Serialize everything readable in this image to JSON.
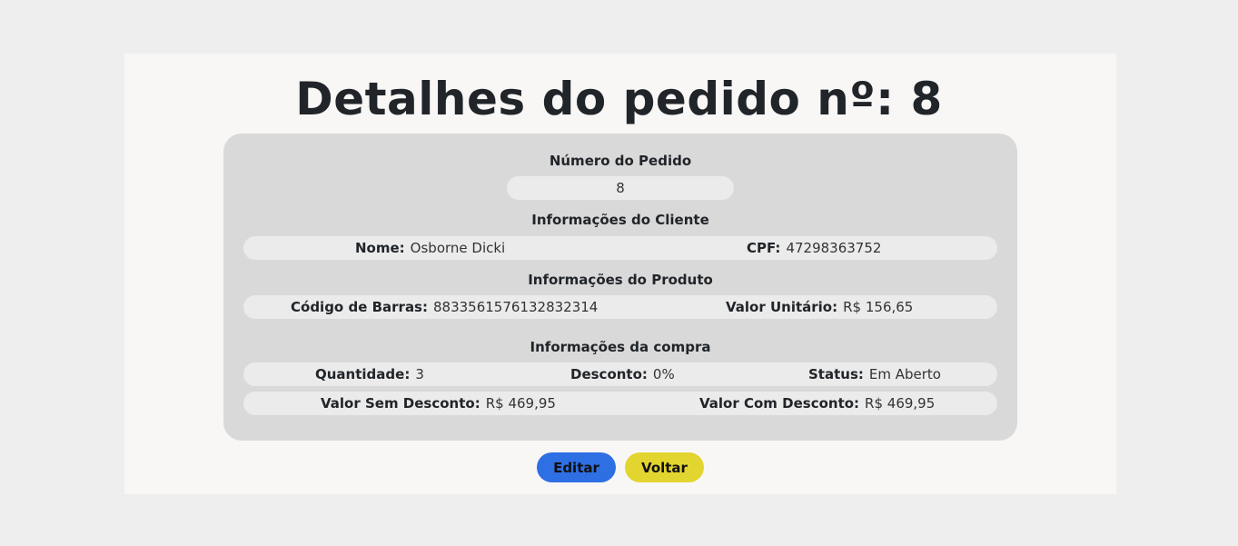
{
  "title": "Detalhes do pedido nº: 8",
  "order_section": {
    "heading": "Número do Pedido",
    "value": "8"
  },
  "client_section": {
    "heading": "Informações do Cliente",
    "name_label": "Nome:",
    "name_value": "Osborne Dicki",
    "cpf_label": "CPF:",
    "cpf_value": "47298363752"
  },
  "product_section": {
    "heading": "Informações do Produto",
    "barcode_label": "Código de Barras:",
    "barcode_value": "8833561576132832314",
    "unit_value_label": "Valor Unitário:",
    "unit_value": "R$ 156,65"
  },
  "purchase_section": {
    "heading": "Informações da compra",
    "quantity_label": "Quantidade:",
    "quantity_value": "3",
    "discount_label": "Desconto:",
    "discount_value": "0%",
    "status_label": "Status:",
    "status_value": "Em Aberto",
    "value_without_discount_label": "Valor Sem Desconto:",
    "value_without_discount": "R$ 469,95",
    "value_with_discount_label": "Valor Com Desconto:",
    "value_with_discount": "R$ 469,95"
  },
  "actions": {
    "edit_label": "Editar",
    "back_label": "Voltar"
  },
  "colors": {
    "edit_button": "#2f6fe4",
    "back_button": "#e2d530",
    "panel": "#d9d9d9",
    "pill": "#ebebeb"
  }
}
